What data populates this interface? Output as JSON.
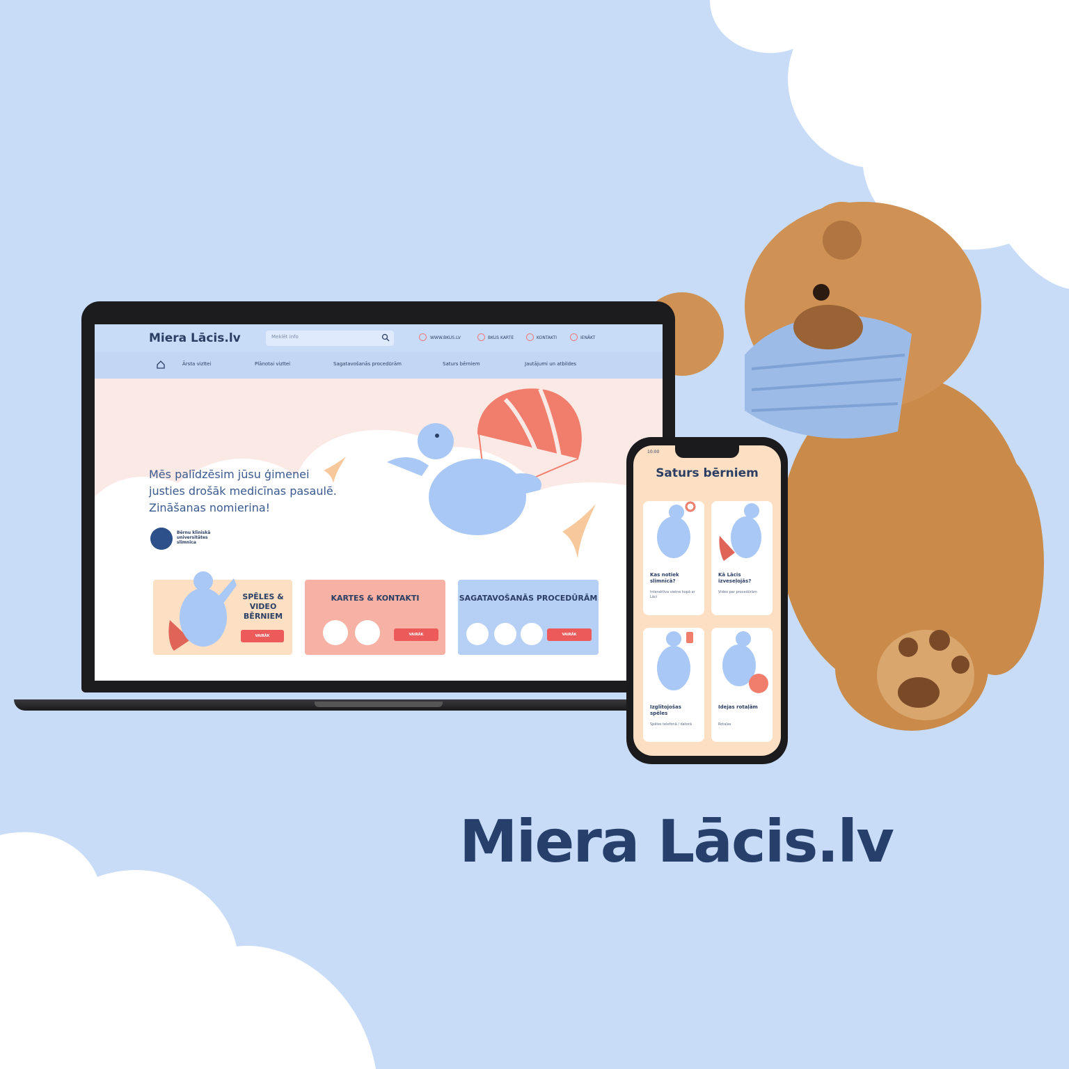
{
  "brand": "Miera Lācis.lv",
  "site": {
    "logo": "Miera Lācis.lv",
    "search_placeholder": "Meklēt info",
    "top_links": [
      "WWW.BKUS.LV",
      "BKUS KARTE",
      "KONTAKTI",
      "IENĀKT"
    ],
    "nav": [
      "Ārsta vizītei",
      "Plānotai vizītei",
      "Sagatavošanās procedūrām",
      "Saturs bērniem",
      "Jautājumi un atbildes"
    ],
    "hero_lines": [
      "Mēs palīdzēsim jūsu ģimenei",
      "justies drošāk medicīnas pasaulē.",
      "Zināšanas nomierina!"
    ],
    "bkus_text": "Bērnu klīniskā universitātes slimnīca",
    "cards": [
      {
        "title": "SPĒLES & VIDEO BĒRNIEM",
        "button": "VAIRĀK"
      },
      {
        "title": "KARTES & KONTAKTI",
        "button": "VAIRĀK"
      },
      {
        "title": "SAGATAVOŠANĀS PROCEDŪRĀM",
        "button": "VAIRĀK"
      }
    ]
  },
  "phone": {
    "time": "10:00",
    "title": "Saturs bērniem",
    "cards": [
      {
        "title": "Kas notiek slimnīcā?",
        "subtitle": "Interaktīva vietne kopā ar Lāci"
      },
      {
        "title": "Kā Lācis izveseļojās?",
        "subtitle": "Video par procedūrām"
      },
      {
        "title": "Izglītojošas spēles",
        "subtitle": "Spēles telefonā / datorā"
      },
      {
        "title": "Idejas rotaļām",
        "subtitle": "Rotaļas"
      }
    ]
  },
  "colors": {
    "background": "#c8dcf8",
    "brand_navy": "#27406b",
    "accent_red": "#ec5a5a",
    "peach": "#fde0c3"
  }
}
